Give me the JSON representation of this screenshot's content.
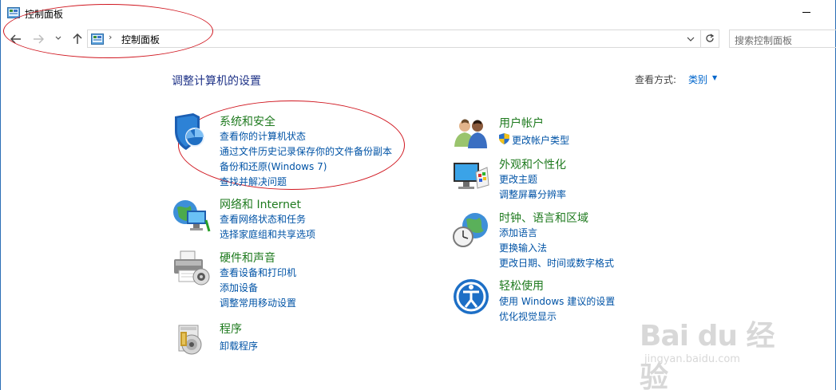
{
  "window": {
    "title": "控制面板"
  },
  "nav": {
    "back_icon": "arrow-left-icon",
    "forward_icon": "arrow-right-icon",
    "address_separator": "›",
    "address": "控制面板",
    "search_placeholder": "搜索控制面板"
  },
  "main": {
    "title": "调整计算机的设置",
    "viewby_label": "查看方式:",
    "viewby_value": "类别"
  },
  "categories": [
    {
      "title": "系统和安全",
      "links": [
        "查看你的计算机状态",
        "通过文件历史记录保存你的文件备份副本",
        "备份和还原(Windows 7)",
        "查找并解决问题"
      ]
    },
    {
      "title": "网络和 Internet",
      "links": [
        "查看网络状态和任务",
        "选择家庭组和共享选项"
      ]
    },
    {
      "title": "硬件和声音",
      "links": [
        "查看设备和打印机",
        "添加设备",
        "调整常用移动设置"
      ]
    },
    {
      "title": "程序",
      "links": [
        "卸载程序"
      ]
    },
    {
      "title": "用户帐户",
      "links": [
        "更改帐户类型"
      ]
    },
    {
      "title": "外观和个性化",
      "links": [
        "更改主题",
        "调整屏幕分辨率"
      ]
    },
    {
      "title": "时钟、语言和区域",
      "links": [
        "添加语言",
        "更换输入法",
        "更改日期、时间或数字格式"
      ]
    },
    {
      "title": "轻松使用",
      "links": [
        "使用 Windows 建议的设置",
        "优化视觉显示"
      ]
    }
  ],
  "watermark": {
    "logo": "Bai du 经验",
    "url": "jingyan.baidu.com"
  },
  "colors": {
    "link": "#0053a6",
    "category_title": "#1e7a1e",
    "page_title": "#1e3287",
    "annotation": "#d0161f"
  }
}
